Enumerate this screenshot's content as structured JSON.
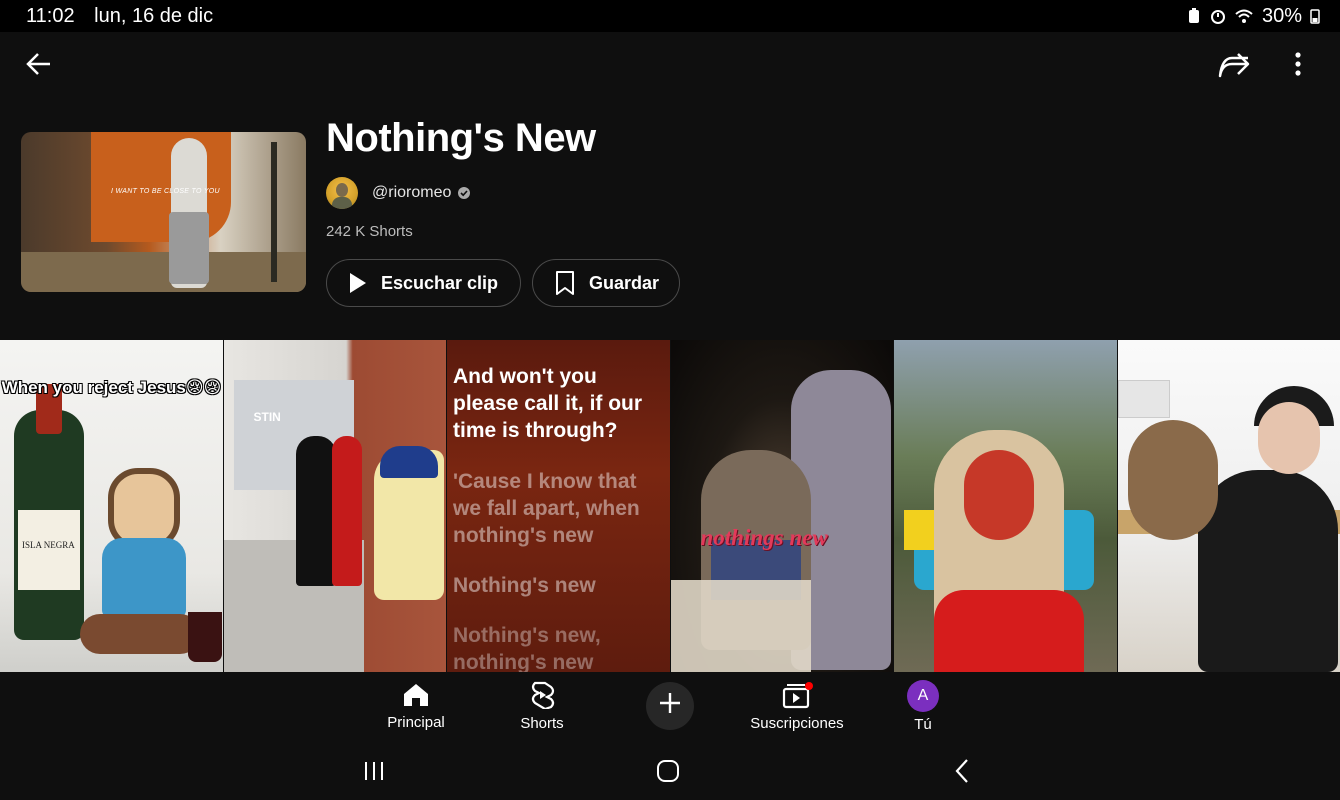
{
  "status_bar": {
    "time": "11:02",
    "date": "lun, 16 de dic",
    "battery": "30%"
  },
  "sound": {
    "title": "Nothing's New",
    "channel": "@rioromeo",
    "shorts_count": "242 K Shorts",
    "thumbnail_caption": "I WANT TO BE CLOSE TO YOU"
  },
  "actions": {
    "play_label": "Escuchar clip",
    "save_label": "Guardar"
  },
  "shorts": [
    {
      "overlay_text": "When you reject Jesus😢😢",
      "bottle_label": "ISLA NEGRA"
    },
    {
      "store_sign": "STIN"
    },
    {
      "lyric1": "And won't you please call it, if our time is through?",
      "lyric2": "'Cause I know that we fall apart, when nothing's new",
      "lyric3": "Nothing's new",
      "lyric4": "Nothing's new, nothing's new"
    },
    {
      "overlay_text": "nothings new"
    },
    {},
    {}
  ],
  "bottom_nav": {
    "home": "Principal",
    "shorts": "Shorts",
    "subscriptions": "Suscripciones",
    "you": "Tú",
    "you_initial": "A"
  },
  "colors": {
    "background": "#0f0f0f",
    "accent_red": "#ff0000",
    "you_avatar": "#7b2fbf"
  }
}
